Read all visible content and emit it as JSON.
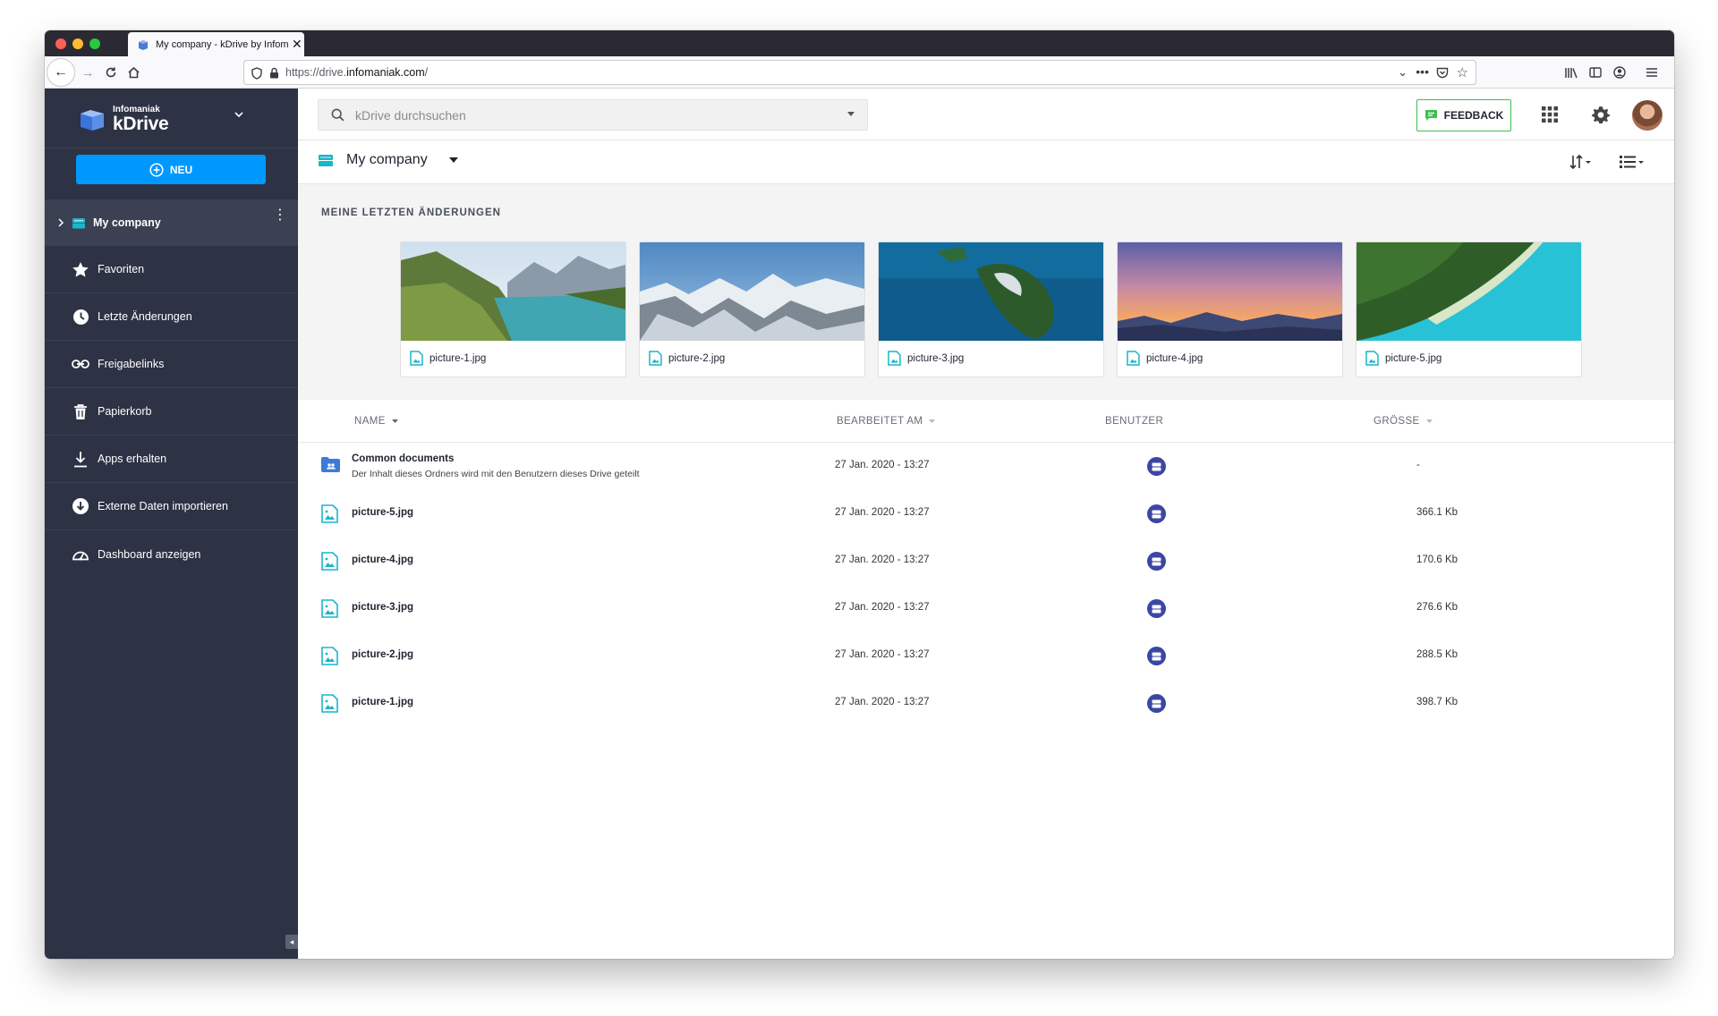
{
  "browser": {
    "tab_title": "My company - kDrive by Infomaniak",
    "url_prefix": "https://drive.",
    "url_domain": "infomaniak.com",
    "url_suffix": "/"
  },
  "sidebar": {
    "brand_small": "Infomaniak",
    "brand_big": "kDrive",
    "new_button": "NEU",
    "active_drive": "My company",
    "items": [
      {
        "label": "Favoriten",
        "icon": "star-icon"
      },
      {
        "label": "Letzte Änderungen",
        "icon": "clock-icon"
      },
      {
        "label": "Freigabelinks",
        "icon": "link-icon"
      },
      {
        "label": "Papierkorb",
        "icon": "trash-icon"
      },
      {
        "label": "Apps erhalten",
        "icon": "download-icon"
      },
      {
        "label": "Externe Daten importieren",
        "icon": "import-icon"
      },
      {
        "label": "Dashboard anzeigen",
        "icon": "dashboard-icon"
      }
    ]
  },
  "topbar": {
    "search_placeholder": "kDrive durchsuchen",
    "feedback": "FEEDBACK"
  },
  "crumb": {
    "title": "My company"
  },
  "recent": {
    "title": "MEINE LETZTEN ÄNDERUNGEN",
    "cards": [
      {
        "name": "picture-1.jpg"
      },
      {
        "name": "picture-2.jpg"
      },
      {
        "name": "picture-3.jpg"
      },
      {
        "name": "picture-4.jpg"
      },
      {
        "name": "picture-5.jpg"
      }
    ]
  },
  "list": {
    "headers": {
      "name": "NAME",
      "date": "BEARBEITET AM",
      "user": "BENUTZER",
      "size": "GRÖSSE"
    },
    "rows": [
      {
        "name": "Common documents",
        "desc": "Der Inhalt dieses Ordners wird mit den Benutzern dieses Drive geteilt",
        "date": "27 Jan. 2020 - 13:27",
        "size": "-",
        "type": "folder"
      },
      {
        "name": "picture-5.jpg",
        "date": "27 Jan. 2020 - 13:27",
        "size": "366.1 Kb",
        "type": "image"
      },
      {
        "name": "picture-4.jpg",
        "date": "27 Jan. 2020 - 13:27",
        "size": "170.6 Kb",
        "type": "image"
      },
      {
        "name": "picture-3.jpg",
        "date": "27 Jan. 2020 - 13:27",
        "size": "276.6 Kb",
        "type": "image"
      },
      {
        "name": "picture-2.jpg",
        "date": "27 Jan. 2020 - 13:27",
        "size": "288.5 Kb",
        "type": "image"
      },
      {
        "name": "picture-1.jpg",
        "date": "27 Jan. 2020 - 13:27",
        "size": "398.7 Kb",
        "type": "image"
      }
    ]
  },
  "colors": {
    "sidebar": "#2d3245",
    "accent": "#0098ff",
    "feedback_border": "#3ebf4f",
    "file_icon": "#19b5c9",
    "user_badge": "#3c46a3"
  }
}
